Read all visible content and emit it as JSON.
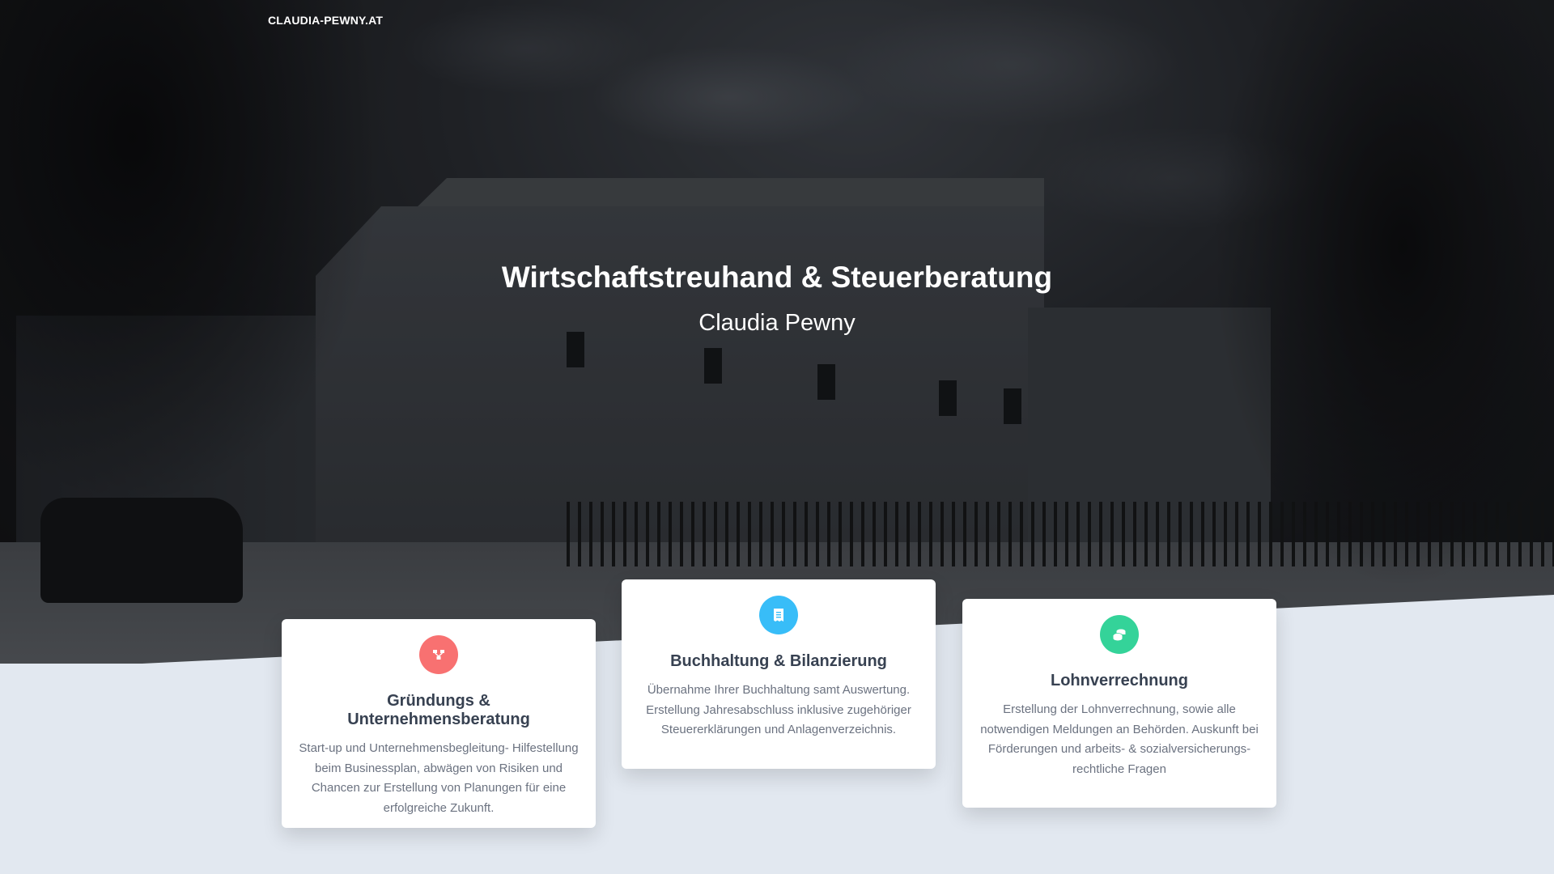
{
  "header": {
    "brand": "CLAUDIA-PEWNY.AT"
  },
  "hero": {
    "title": "Wirtschaftstreuhand & Steuerberatung",
    "subtitle": "Claudia Pewny"
  },
  "cards": [
    {
      "icon": "sitemap-icon",
      "icon_color": "#f87171",
      "title": "Gründungs & Unternehmensberatung",
      "text": "Start-up und Unternehmensbegleitung- Hilfestellung beim Businessplan, abwägen von Risiken und Chancen zur Erstellung von Planungen für eine erfolgreiche Zukunft."
    },
    {
      "icon": "receipt-icon",
      "icon_color": "#38bdf8",
      "title": "Buchhaltung & Bilanzierung",
      "text": "Übernahme Ihrer Buchhaltung samt Auswertung. Erstellung Jahresabschluss inklusive zugehöriger Steuererklärungen und Anlagenverzeichnis."
    },
    {
      "icon": "coins-icon",
      "icon_color": "#34d399",
      "title": "Lohnverrechnung",
      "text": "Erstellung der Lohnverrechnung, sowie alle notwendigen Meldungen an Behörden. Auskunft bei Förderungen und arbeits- & sozialversicherungs- rechtliche Fragen"
    }
  ]
}
